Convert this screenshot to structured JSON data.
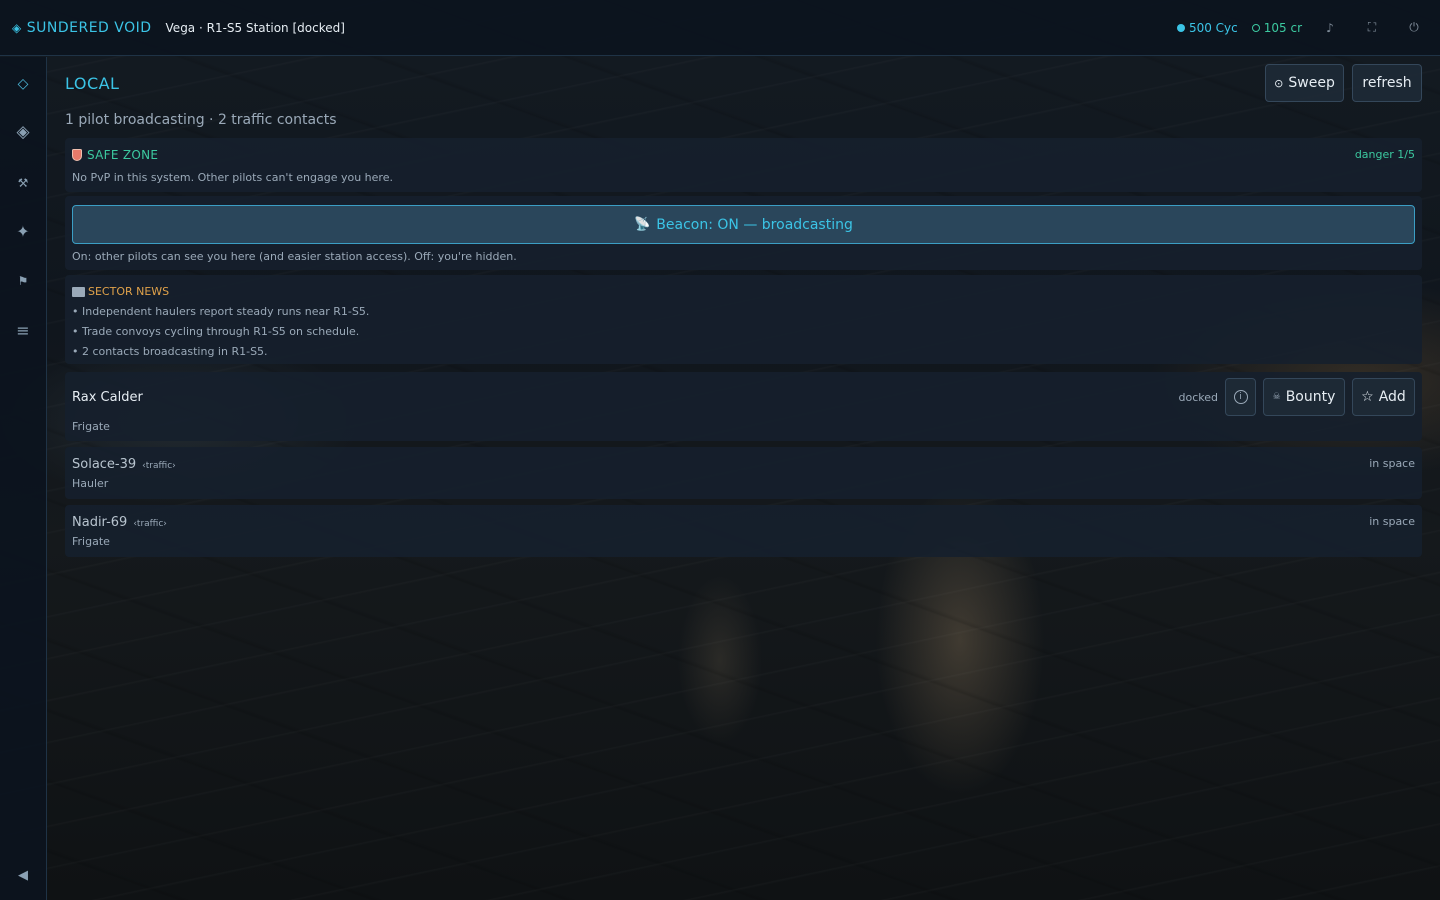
{
  "topbar": {
    "brand": "SUNDERED VOID",
    "location": "Vega · R1-S5 Station [docked]",
    "cycles": "500 Cyc",
    "credits": "105 cr",
    "icons": [
      "music-icon",
      "fullscreen-icon",
      "power-icon"
    ]
  },
  "sidebar": {
    "items": [
      "diamond-outline-icon",
      "diamond-filled-icon",
      "tools-icon",
      "star-icon",
      "flag-icon",
      "menu-icon"
    ],
    "collapse": "collapse-arrow-icon"
  },
  "panel": {
    "title": "LOCAL",
    "summary": "1 pilot broadcasting · 2 traffic contacts",
    "sweep_label": "Sweep",
    "refresh_label": "refresh"
  },
  "safe_zone": {
    "title": "SAFE ZONE",
    "description": "No PvP in this system. Other pilots can't engage you here.",
    "danger": "danger 1/5"
  },
  "beacon": {
    "label": "Beacon: ON — broadcasting",
    "note": "On: other pilots can see you here (and easier station access). Off: you're hidden."
  },
  "news": {
    "title": "SECTOR NEWS",
    "items": [
      "• Independent haulers report steady runs near R1-S5.",
      "• Trade convoys cycling through R1-S5 on schedule.",
      "• 2 contacts broadcasting in R1-S5."
    ]
  },
  "contacts": [
    {
      "name": "Rax Calder",
      "ship": "Frigate",
      "status": "docked",
      "tag": "",
      "bounty_label": "Bounty",
      "add_label": "Add"
    },
    {
      "name": "Solace-39",
      "ship": "Hauler",
      "status": "in space",
      "tag": "‹traffic›"
    },
    {
      "name": "Nadir-69",
      "ship": "Frigate",
      "status": "in space",
      "tag": "‹traffic›"
    }
  ],
  "colors": {
    "accent": "#3bc4e6",
    "safe": "#3cc9a0",
    "news": "#e0a24a"
  }
}
